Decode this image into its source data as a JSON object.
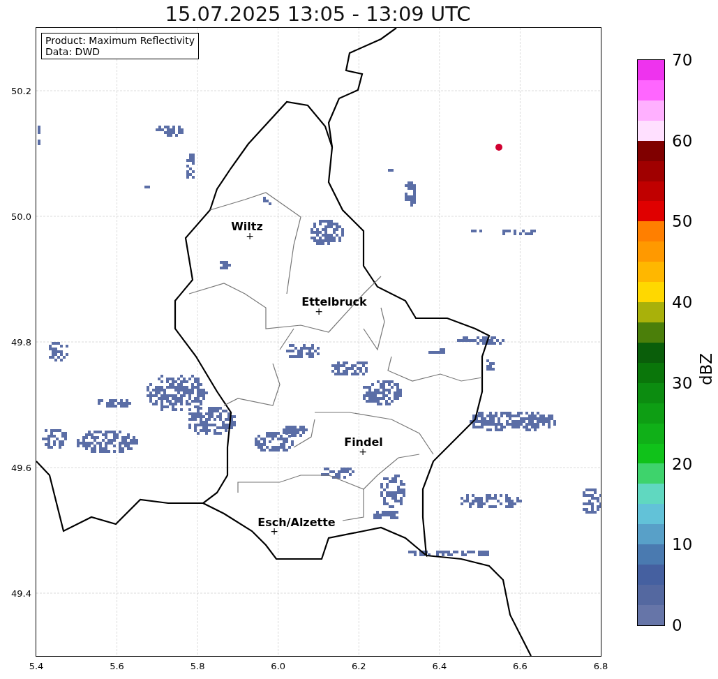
{
  "title": "15.07.2025 13:05 - 13:09 UTC",
  "info_box": {
    "lines": [
      "Product: Maximum Reflectivity",
      "Data: DWD"
    ]
  },
  "map": {
    "places": [
      {
        "name": "Wiltz",
        "marker": "+"
      },
      {
        "name": "Ettelbruck",
        "marker": "+"
      },
      {
        "name": "Findel",
        "marker": "+"
      },
      {
        "name": "Esch/Alzette",
        "marker": "+"
      }
    ]
  },
  "y_axis": {
    "ticks": [
      "50.2",
      "50.0",
      "49.8",
      "49.6",
      "49.4"
    ]
  },
  "x_axis": {
    "ticks": [
      "5.4",
      "5.6",
      "5.8",
      "6.0",
      "6.2",
      "6.4",
      "6.6",
      "6.8"
    ]
  },
  "colorbar": {
    "label": "dBZ",
    "ticks": [
      "70",
      "60",
      "50",
      "40",
      "30",
      "20",
      "10",
      "0"
    ],
    "steps": [
      {
        "color": "#ee33ee"
      },
      {
        "color": "#ff66ff"
      },
      {
        "color": "#ffb0ff"
      },
      {
        "color": "#ffe0ff"
      },
      {
        "color": "#800000"
      },
      {
        "color": "#a00000"
      },
      {
        "color": "#c00000"
      },
      {
        "color": "#e00000"
      },
      {
        "color": "#ff7f00"
      },
      {
        "color": "#ff9900"
      },
      {
        "color": "#ffb700"
      },
      {
        "color": "#ffd800"
      },
      {
        "color": "#a9b10a"
      },
      {
        "color": "#4b7f0a"
      },
      {
        "color": "#0a5e0a"
      },
      {
        "color": "#0a760a"
      },
      {
        "color": "#0c8c10"
      },
      {
        "color": "#0e9e14"
      },
      {
        "color": "#10b018"
      },
      {
        "color": "#10c21a"
      },
      {
        "color": "#3ed36c"
      },
      {
        "color": "#60d8c0"
      },
      {
        "color": "#62c2d8"
      },
      {
        "color": "#58a0c8"
      },
      {
        "color": "#4a7ab0"
      },
      {
        "color": "#4560a0"
      },
      {
        "color": "#5468a0"
      },
      {
        "color": "#6675a8"
      }
    ]
  }
}
